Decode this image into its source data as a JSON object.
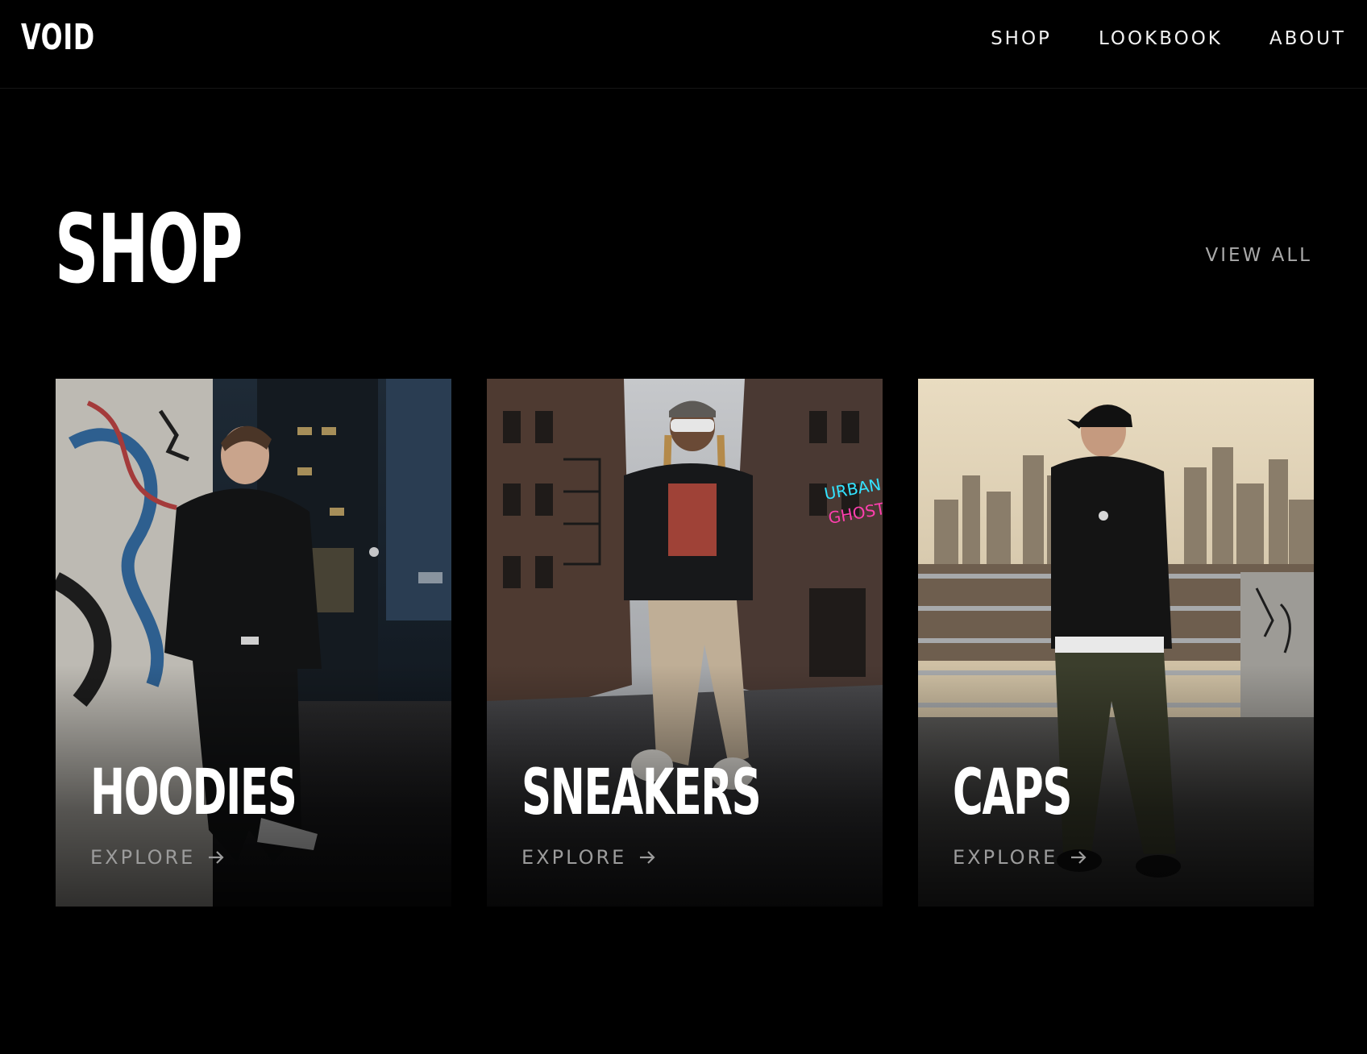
{
  "header": {
    "logo": "VOID",
    "nav": [
      {
        "label": "SHOP"
      },
      {
        "label": "LOOKBOOK"
      },
      {
        "label": "ABOUT"
      }
    ]
  },
  "section": {
    "title": "SHOP",
    "view_all": "VIEW ALL"
  },
  "cards": [
    {
      "title": "HOODIES",
      "cta": "EXPLORE",
      "icon": "arrow-right-icon"
    },
    {
      "title": "SNEAKERS",
      "cta": "EXPLORE",
      "icon": "arrow-right-icon"
    },
    {
      "title": "CAPS",
      "cta": "EXPLORE",
      "icon": "arrow-right-icon"
    }
  ],
  "colors": {
    "background": "#000000",
    "text": "#ffffff",
    "muted": "#a9a9a9"
  }
}
